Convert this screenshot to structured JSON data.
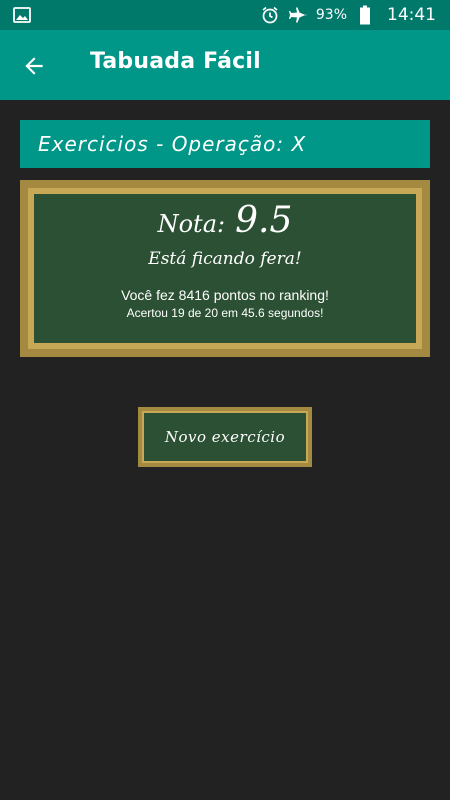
{
  "status_bar": {
    "battery_percent": "93%",
    "time": "14:41",
    "icons": [
      "image-icon",
      "alarm-icon",
      "airplane-icon",
      "battery-icon"
    ]
  },
  "app_bar": {
    "title": "Tabuada Fácil",
    "back_icon": "arrow-back-icon"
  },
  "section": {
    "header": "Exercicios - Operação: X"
  },
  "result": {
    "grade_label": "Nota:",
    "grade_value": "9.5",
    "praise": "Está ficando fera!",
    "ranking": "Você fez 8416 pontos no ranking!",
    "stats": "Acertou 19 de 20 em 45.6 segundos!"
  },
  "actions": {
    "new_exercise_label": "Novo exercício"
  },
  "colors": {
    "status_bar": "#00796b",
    "app_bar": "#009688",
    "background": "#222222",
    "board_green": "#2c5034",
    "board_frame": "#c7a856"
  }
}
